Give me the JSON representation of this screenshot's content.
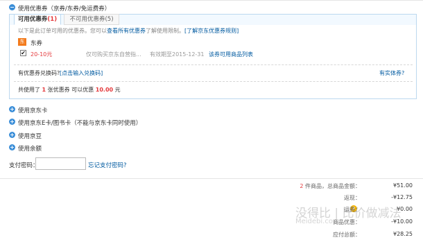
{
  "coupon_section": {
    "toggle": "−",
    "title": "使用优惠券（京券/东券/免运费券）",
    "tabs": [
      {
        "label": "可用优惠券",
        "count": "(1)"
      },
      {
        "label": "不可用优惠券",
        "count": "(5)"
      }
    ],
    "tip_text": "以下是此订单可用的优惠券。您可以",
    "tip_link_all": "查看所有优惠券",
    "tip_text2": "了解使用限制。",
    "tip_link_rules": "[了解京东优惠券规则]",
    "group_badge": "东",
    "group_label": "东券",
    "coupon": {
      "checked": "✔",
      "amount": "20-10元",
      "desc": "仅可购买京东自营指...",
      "expire": "有效期至2015-12-31",
      "link": "该券可用商品列表"
    },
    "exchange_label": "有优惠券兑换码?",
    "exchange_link": "[点击输入兑换码]",
    "physical_link": "有实体券?",
    "summary_prefix": "共使用了",
    "summary_count": "1",
    "summary_mid": "张优惠券   可以优惠",
    "summary_amount": "10.00",
    "summary_suffix": "元"
  },
  "other_sections": [
    {
      "toggle": "+",
      "label": "使用京东卡"
    },
    {
      "toggle": "+",
      "label": "使用京东E卡/图书卡（不能与京东卡同时使用）"
    },
    {
      "toggle": "+",
      "label": "使用京豆"
    },
    {
      "toggle": "+",
      "label": "使用余额"
    }
  ],
  "payment_password": {
    "label": "支付密码：",
    "value": "",
    "forgot_link": "忘记支付密码?"
  },
  "order_summary": {
    "items_count": "2",
    "items_label": "件商品，总商品金额：",
    "items_value": "¥51.00",
    "rebate_label": "返现：",
    "rebate_value": "-¥12.75",
    "help_icon": "?",
    "shipping_label": "运费：",
    "shipping_value": "¥0.00",
    "discount_label": "商品优惠：",
    "discount_value": "-¥10.00",
    "total_label": "应付总额：",
    "total_value": "¥28.25"
  },
  "watermark": {
    "text": "没得比 | 比价做减法",
    "sub": "Meidebi.com"
  },
  "colors": {
    "link": "#005aa0",
    "accent_red": "#e4393c",
    "toggle_blue": "#3b8ed8",
    "panel_border": "#bcd8ef",
    "jd_orange": "#f37b1d"
  }
}
